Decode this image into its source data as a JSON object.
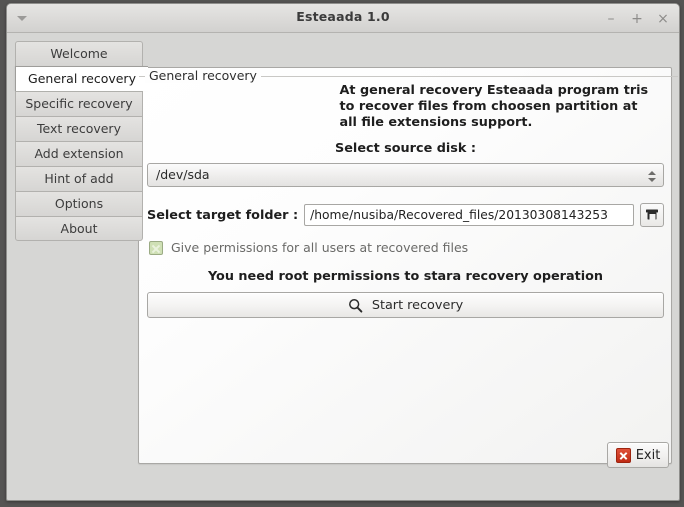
{
  "window": {
    "title": "Esteaada 1.0",
    "menu_icon": "chevron-down-icon",
    "minimize_glyph": "–",
    "maximize_glyph": "+",
    "close_glyph": "×"
  },
  "tabs": [
    {
      "label": "Welcome",
      "active": false
    },
    {
      "label": "General recovery",
      "active": true
    },
    {
      "label": "Specific recovery",
      "active": false
    },
    {
      "label": "Text recovery",
      "active": false
    },
    {
      "label": "Add extension",
      "active": false
    },
    {
      "label": "Hint of add",
      "active": false
    },
    {
      "label": "Options",
      "active": false
    },
    {
      "label": "About",
      "active": false
    }
  ],
  "panel": {
    "legend": "General recovery",
    "description_lines": [
      "At general recovery Esteaada program tris",
      "to recover files from choosen partition at",
      "all file extensions support."
    ],
    "source_disk": {
      "label": "Select source disk :",
      "value": "/dev/sda",
      "spinner_up_icon": "arrow-up-icon",
      "spinner_down_icon": "arrow-down-icon"
    },
    "target_folder": {
      "label": "Select target folder :",
      "value": "/home/nusiba/Recovered_files/20130308143253",
      "placeholder": "",
      "browse_icon": "folder-icon"
    },
    "permissions": {
      "label": "Give permissions for all users at recovered files",
      "checked": true,
      "checkbox_icon": "checkbox-checked-icon"
    },
    "root_warning": "You need root permissions to stara recovery operation",
    "start_button": {
      "label": "Start recovery",
      "icon": "search-icon"
    }
  },
  "footer": {
    "exit_button": {
      "label": "Exit",
      "icon": "close-x-icon"
    }
  },
  "colors": {
    "accent_green": "#cfe0b5",
    "exit_red": "#bf2a14",
    "window_bg": "#d6d6d4",
    "panel_bg": "#ffffff"
  }
}
